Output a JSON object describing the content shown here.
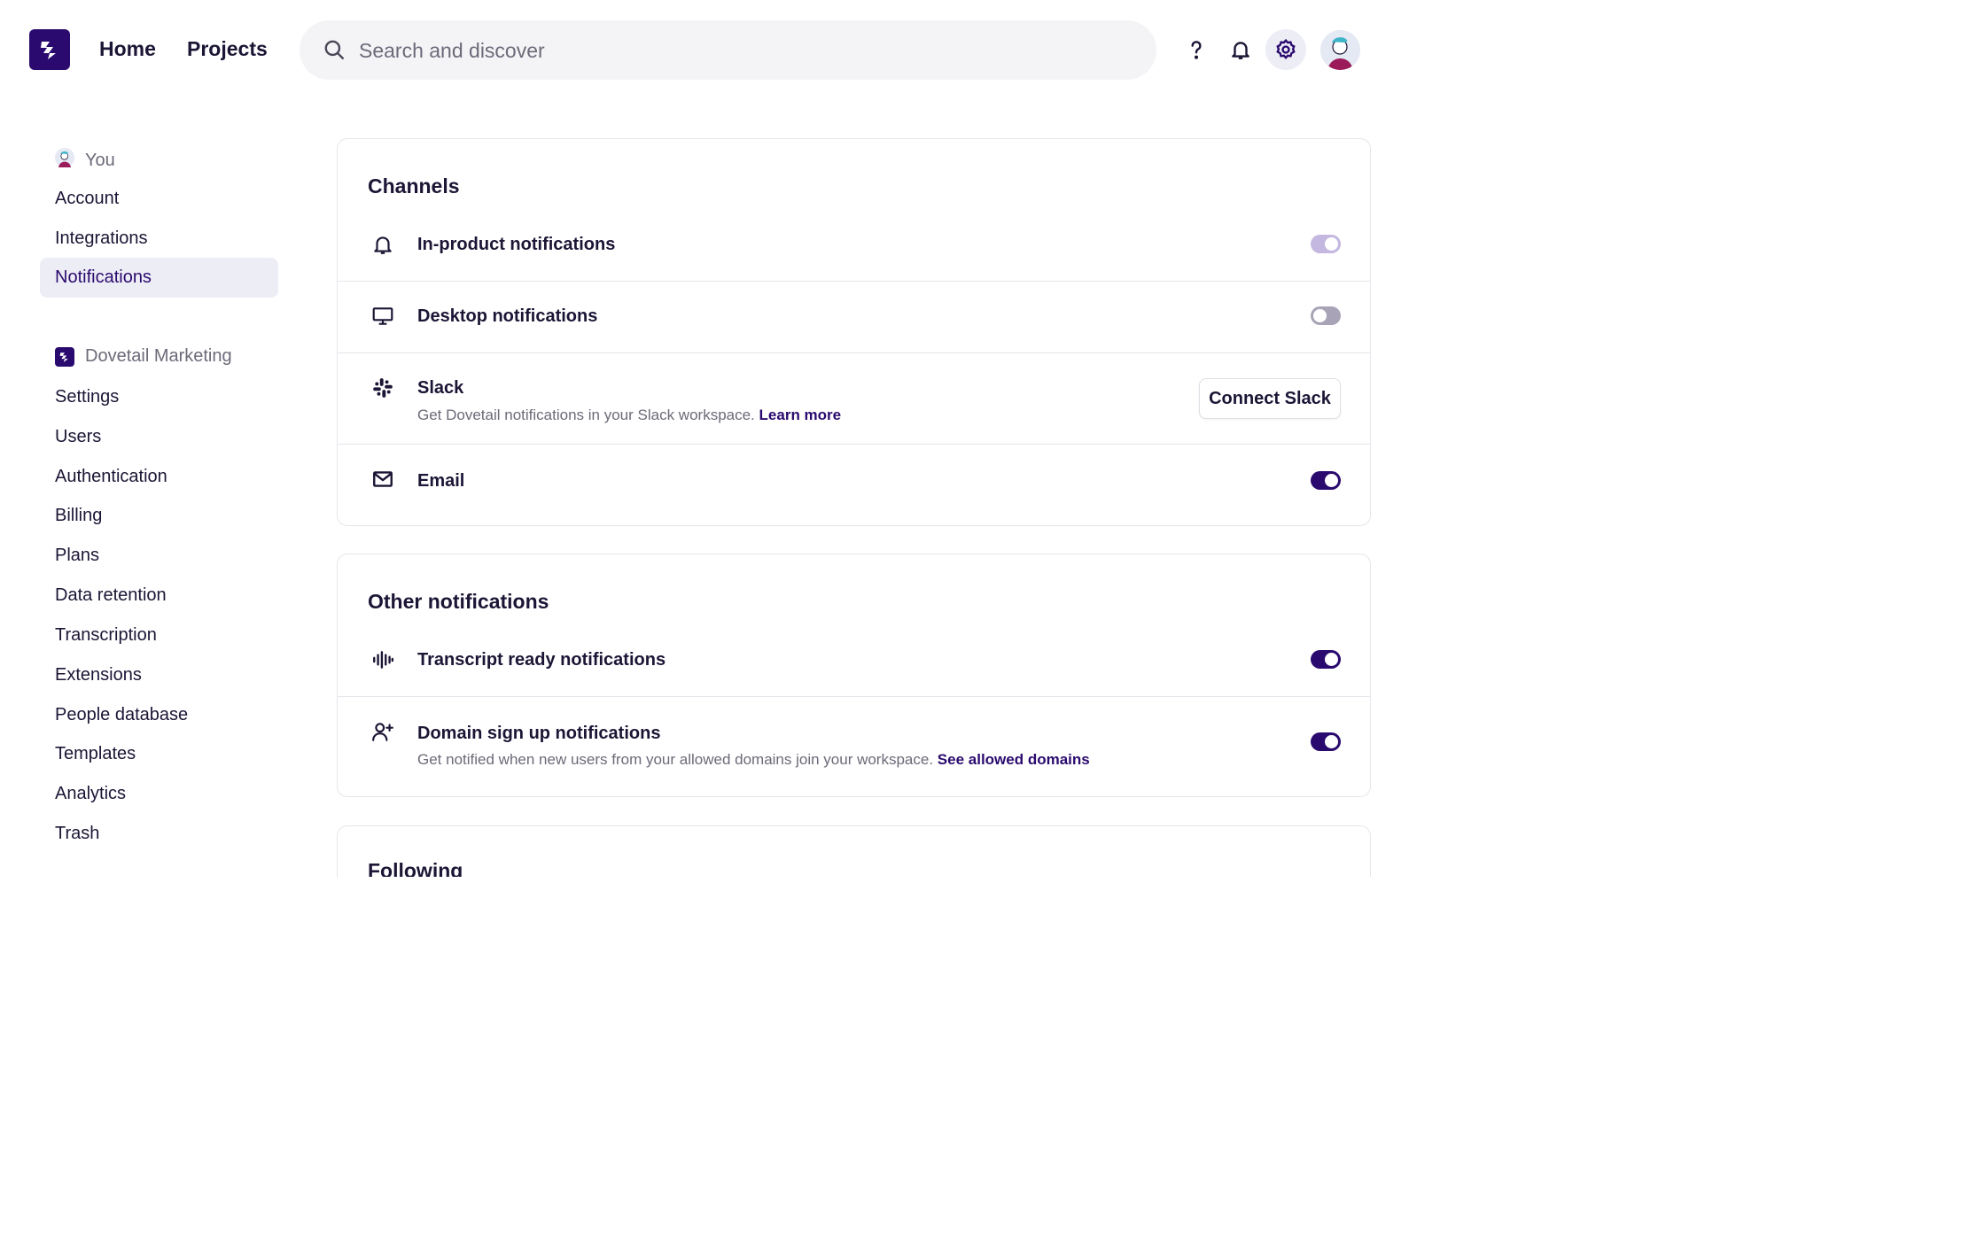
{
  "header": {
    "nav": [
      {
        "label": "Home"
      },
      {
        "label": "Projects"
      }
    ],
    "search": {
      "placeholder": "Search and discover",
      "icon": "search-icon"
    },
    "icons": [
      "help-icon",
      "bell-icon",
      "gear-icon"
    ]
  },
  "sidebar": {
    "you": {
      "label": "You",
      "items": [
        {
          "label": "Account"
        },
        {
          "label": "Integrations"
        },
        {
          "label": "Notifications",
          "active": true
        }
      ]
    },
    "workspace": {
      "label": "Dovetail Marketing",
      "items": [
        {
          "label": "Settings"
        },
        {
          "label": "Users"
        },
        {
          "label": "Authentication"
        },
        {
          "label": "Billing"
        },
        {
          "label": "Plans"
        },
        {
          "label": "Data retention"
        },
        {
          "label": "Transcription"
        },
        {
          "label": "Extensions"
        },
        {
          "label": "People database"
        },
        {
          "label": "Templates"
        },
        {
          "label": "Analytics"
        },
        {
          "label": "Trash"
        }
      ]
    }
  },
  "channels": {
    "title": "Channels",
    "rows": [
      {
        "icon": "bell-icon",
        "label": "In-product notifications",
        "toggle": "on-disabled"
      },
      {
        "icon": "monitor-icon",
        "label": "Desktop notifications",
        "toggle": "off"
      },
      {
        "icon": "slack-icon",
        "label": "Slack",
        "description": "Get Dovetail notifications in your Slack workspace.",
        "link": "Learn more",
        "button": "Connect Slack"
      },
      {
        "icon": "mail-icon",
        "label": "Email",
        "toggle": "on"
      }
    ]
  },
  "other": {
    "title": "Other notifications",
    "rows": [
      {
        "icon": "waveform-icon",
        "label": "Transcript ready notifications",
        "toggle": "on"
      },
      {
        "icon": "user-plus-icon",
        "label": "Domain sign up notifications",
        "description": "Get notified when new users from your allowed domains join your workspace.",
        "link": "See allowed domains",
        "toggle": "on"
      }
    ]
  },
  "following": {
    "title": "Following"
  },
  "colors": {
    "brand": "#2a0a6e",
    "toggle_off": "#a9a3b7",
    "toggle_disabled": "#c4b8e0"
  }
}
